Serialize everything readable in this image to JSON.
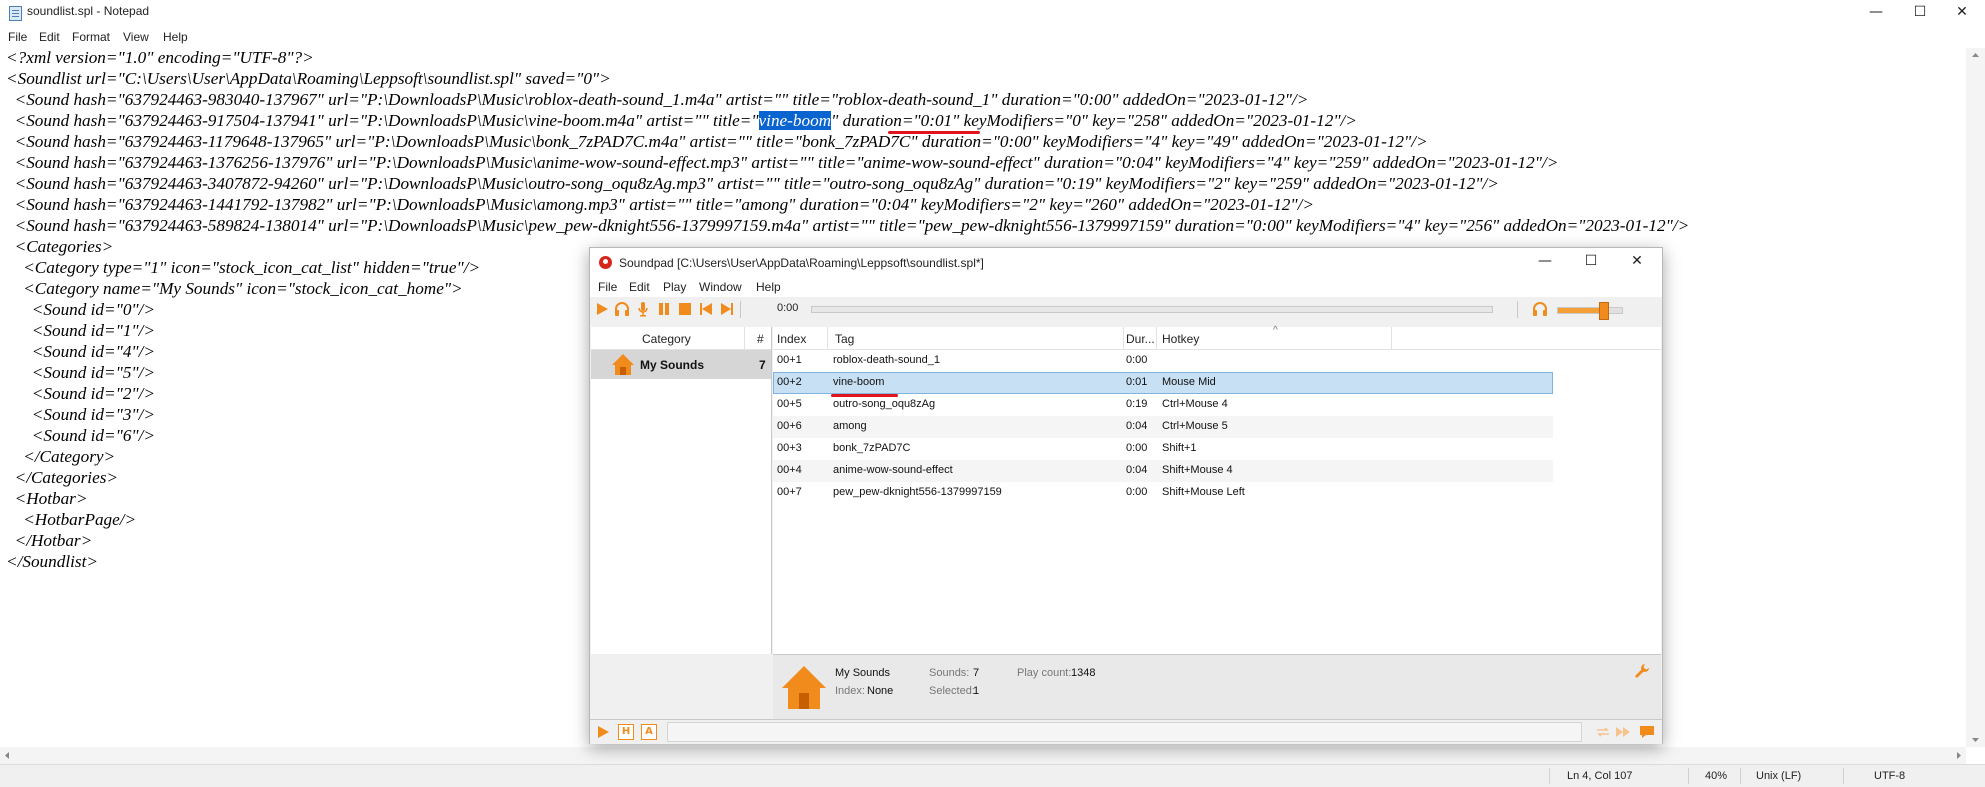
{
  "notepad": {
    "title": "soundlist.spl - Notepad",
    "window_controls": {
      "minimize": "—",
      "maximize": "☐",
      "close": "✕"
    },
    "menu": [
      "File",
      "Edit",
      "Format",
      "View",
      "Help"
    ],
    "lines": [
      "<?xml version=\"1.0\" encoding=\"UTF-8\"?>",
      "<Soundlist url=\"C:\\Users\\User\\AppData\\Roaming\\Leppsoft\\soundlist.spl\" saved=\"0\">",
      "  <Sound hash=\"637924463-983040-137967\" url=\"P:\\DownloadsP\\Music\\roblox-death-sound_1.m4a\" artist=\"\" title=\"roblox-death-sound_1\" duration=\"0:00\" addedOn=\"2023-01-12\"/>",
      "  <Sound hash=\"637924463-917504-137941\" url=\"P:\\DownloadsP\\Music\\vine-boom.m4a\" artist=\"\" title=\"",
      "  <Sound hash=\"637924463-1179648-137965\" url=\"P:\\DownloadsP\\Music\\bonk_7zPAD7C.m4a\" artist=\"\" title=\"bonk_7zPAD7C\" duration=\"0:00\" keyModifiers=\"4\" key=\"49\" addedOn=\"2023-01-12\"/>",
      "  <Sound hash=\"637924463-1376256-137976\" url=\"P:\\DownloadsP\\Music\\anime-wow-sound-effect.mp3\" artist=\"\" title=\"anime-wow-sound-effect\" duration=\"0:04\" keyModifiers=\"4\" key=\"259\" addedOn=\"2023-01-12\"/>",
      "  <Sound hash=\"637924463-3407872-94260\" url=\"P:\\DownloadsP\\Music\\outro-song_oqu8zAg.mp3\" artist=\"\" title=\"outro-song_oqu8zAg\" duration=\"0:19\" keyModifiers=\"2\" key=\"259\" addedOn=\"2023-01-12\"/>",
      "  <Sound hash=\"637924463-1441792-137982\" url=\"P:\\DownloadsP\\Music\\among.mp3\" artist=\"\" title=\"among\" duration=\"0:04\" keyModifiers=\"2\" key=\"260\" addedOn=\"2023-01-12\"/>",
      "  <Sound hash=\"637924463-589824-138014\" url=\"P:\\DownloadsP\\Music\\pew_pew-dknight556-1379997159.m4a\" artist=\"\" title=\"pew_pew-dknight556-1379997159\" duration=\"0:00\" keyModifiers=\"4\" key=\"256\" addedOn=\"2023-01-12\"/>",
      "  <Categories>",
      "    <Category type=\"1\" icon=\"stock_icon_cat_list\" hidden=\"true\"/>",
      "    <Category name=\"My Sounds\" icon=\"stock_icon_cat_home\">",
      "      <Sound id=\"0\"/>",
      "      <Sound id=\"1\"/>",
      "      <Sound id=\"4\"/>",
      "      <Sound id=\"5\"/>",
      "      <Sound id=\"2\"/>",
      "      <Sound id=\"3\"/>",
      "      <Sound id=\"6\"/>",
      "    </Category>",
      "  </Categories>",
      "  <Hotbar>",
      "    <HotbarPage/>",
      "  </Hotbar>",
      "</Soundlist>"
    ],
    "line3_selected": "vine-boom",
    "line3_tail": "\" duration=\"0:01\" keyModifiers=\"0\" key=\"258\" addedOn=\"2023-01-12\"/>",
    "status": {
      "position": "Ln 4, Col 107",
      "zoom": "40%",
      "line_ending": "Unix (LF)",
      "encoding": "UTF-8"
    }
  },
  "soundpad": {
    "title": "Soundpad [C:\\Users\\User\\AppData\\Roaming\\Leppsoft\\soundlist.spl*]",
    "window_controls": {
      "minimize": "—",
      "maximize": "☐",
      "close": "✕"
    },
    "menu": [
      "File",
      "Edit",
      "Play",
      "Window",
      "Help"
    ],
    "toolbar": {
      "time": "0:00",
      "icons": [
        "play-icon",
        "headphones-icon",
        "microphone-icon",
        "pause-icon",
        "stop-icon",
        "previous-icon",
        "next-icon"
      ],
      "volume": 0.7
    },
    "categories": {
      "header_category": "Category",
      "header_count": "#",
      "items": [
        {
          "name": "My Sounds",
          "count": "7",
          "icon": "house-icon"
        }
      ]
    },
    "list": {
      "columns": [
        "Index",
        "Tag",
        "Dur...",
        "Hotkey"
      ],
      "sort_indicator": "^",
      "rows": [
        {
          "index": "00+1",
          "tag": "roblox-death-sound_1",
          "duration": "0:00",
          "hotkey": ""
        },
        {
          "index": "00+2",
          "tag": "vine-boom",
          "duration": "0:01",
          "hotkey": "Mouse Mid"
        },
        {
          "index": "00+5",
          "tag": "outro-song_oqu8zAg",
          "duration": "0:19",
          "hotkey": "Ctrl+Mouse 4"
        },
        {
          "index": "00+6",
          "tag": "among",
          "duration": "0:04",
          "hotkey": "Ctrl+Mouse 5"
        },
        {
          "index": "00+3",
          "tag": "bonk_7zPAD7C",
          "duration": "0:00",
          "hotkey": "Shift+1"
        },
        {
          "index": "00+4",
          "tag": "anime-wow-sound-effect",
          "duration": "0:04",
          "hotkey": "Shift+Mouse 4"
        },
        {
          "index": "00+7",
          "tag": "pew_pew-dknight556-1379997159",
          "duration": "0:00",
          "hotkey": "Shift+Mouse Left"
        }
      ],
      "selected_index": 1
    },
    "info": {
      "category_name": "My Sounds",
      "index_label": "Index:",
      "index_value": "None",
      "sounds_label": "Sounds:",
      "sounds_value": "7",
      "selected_label": "Selected:",
      "selected_value": "1",
      "playcount_label": "Play count:",
      "playcount_value": "1348"
    },
    "bottom_bar": {
      "h_label": "H",
      "a_label": "A"
    },
    "colors": {
      "accent": "#f08b1c",
      "selection": "#c7e0f4",
      "notepad_selection": "#0a64d0",
      "underline": "#e0141a"
    }
  }
}
